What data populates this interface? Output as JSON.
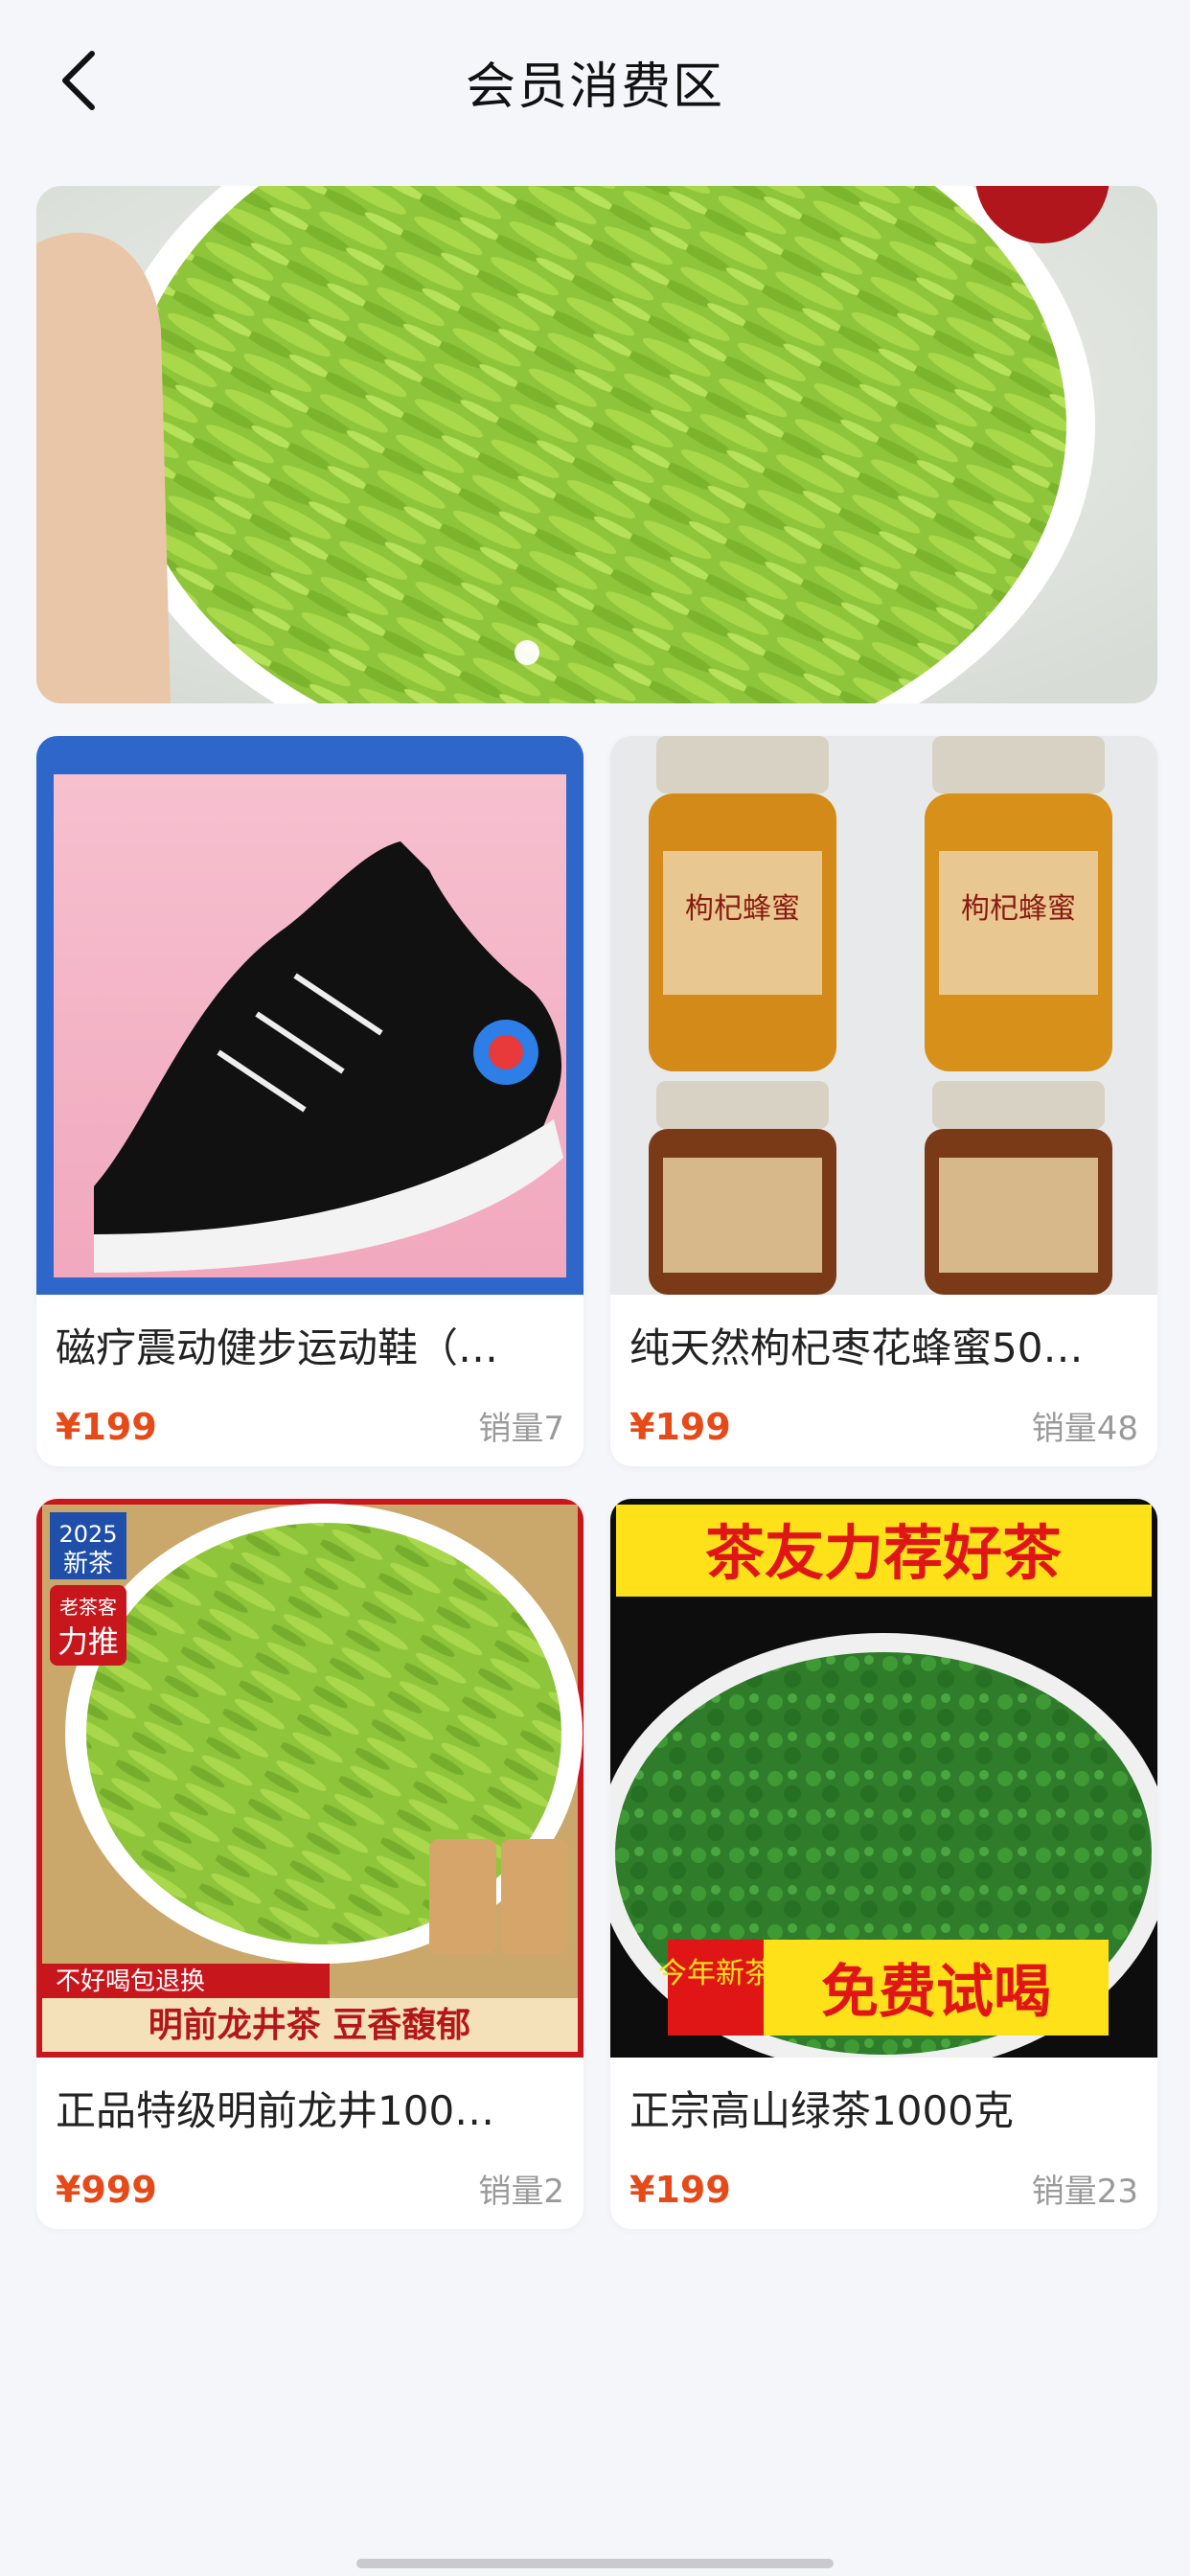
{
  "header": {
    "title": "会员消费区",
    "back_icon": "chevron-left-icon"
  },
  "banner": {
    "image_desc": "green-tea-bowl-image",
    "active_index": 0,
    "dots": 1
  },
  "products": [
    {
      "name": "磁疗震动健步运动鞋（…",
      "price": "¥199",
      "sales": "销量7",
      "image": "shoe-image"
    },
    {
      "name": "纯天然枸杞枣花蜂蜜50…",
      "price": "¥199",
      "sales": "销量48",
      "image": "honey-jar-image",
      "image_text": [
        "枸杞蜂蜜",
        "枸杞蜂蜜"
      ]
    },
    {
      "name": "正品特级明前龙井100…",
      "price": "¥999",
      "sales": "销量2",
      "image": "longjing-tea-image",
      "image_text": {
        "badge_year": "2025",
        "badge_new": "新茶",
        "badge_sub": "老茶客",
        "badge_main": "力推",
        "strip_top": "不好喝包退换",
        "strip_bottom": "明前龙井茶  豆香馥郁"
      }
    },
    {
      "name": "正宗高山绿茶1000克",
      "price": "¥199",
      "sales": "销量23",
      "image": "green-tea-image",
      "image_text": {
        "top": "茶友力荐好茶",
        "tag": "今年新茶",
        "bottom": "免费试喝"
      }
    }
  ],
  "colors": {
    "price": "#e64a19",
    "background": "#f5f6fa"
  }
}
